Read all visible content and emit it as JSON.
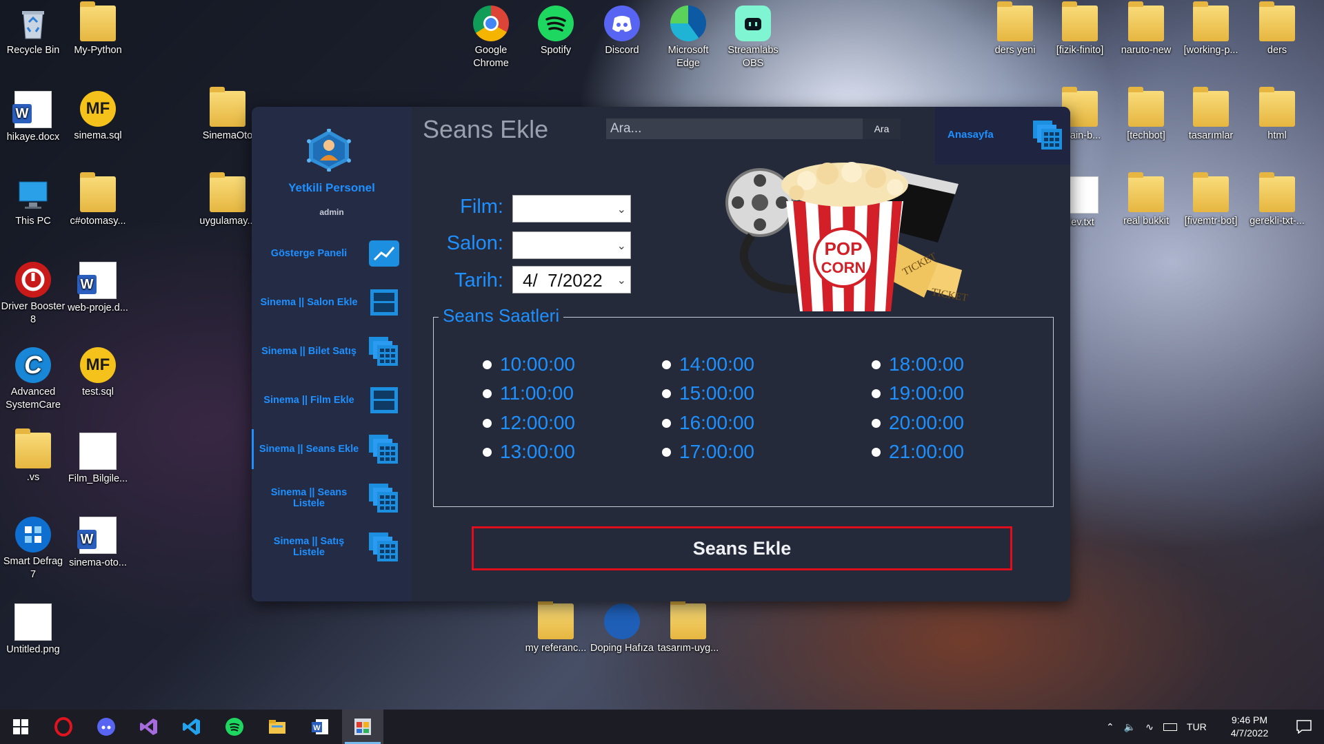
{
  "desktop": {
    "icons": [
      {
        "label": "Recycle Bin"
      },
      {
        "label": "My-Python"
      },
      {
        "label": "hikaye.docx"
      },
      {
        "label": "sinema.sql"
      },
      {
        "label": "SinemaOto"
      },
      {
        "label": "This PC"
      },
      {
        "label": "c#otomasy..."
      },
      {
        "label": "uygulamay..."
      },
      {
        "label": "Driver Booster 8"
      },
      {
        "label": "web-proje.d..."
      },
      {
        "label": "Advanced SystemCare"
      },
      {
        "label": "test.sql"
      },
      {
        "label": ".vs"
      },
      {
        "label": "Film_Bilgile..."
      },
      {
        "label": "Smart Defrag 7"
      },
      {
        "label": "sinema-oto..."
      },
      {
        "label": "Untitled.png"
      },
      {
        "label": "Google Chrome"
      },
      {
        "label": "Spotify"
      },
      {
        "label": "Discord"
      },
      {
        "label": "Microsoft Edge"
      },
      {
        "label": "Streamlabs OBS"
      },
      {
        "label": "ders yeni"
      },
      {
        "label": "[fizik-finito]"
      },
      {
        "label": "naruto-new"
      },
      {
        "label": "[working-p..."
      },
      {
        "label": "ders"
      },
      {
        "label": "ytrain-b..."
      },
      {
        "label": "[techbot]"
      },
      {
        "label": "tasarımlar"
      },
      {
        "label": "html"
      },
      {
        "label": "dev.txt"
      },
      {
        "label": "real bukkit"
      },
      {
        "label": "[fivemtr-bot]"
      },
      {
        "label": "gerekli-txt-..."
      },
      {
        "label": "my referanc..."
      },
      {
        "label": "Doping Hafıza"
      },
      {
        "label": "tasarım-uyg..."
      }
    ]
  },
  "app": {
    "sidebar": {
      "user_title": "Yetkili Personel",
      "user_role": "admin",
      "items": [
        {
          "label": "Gösterge Paneli"
        },
        {
          "label": "Sinema || Salon Ekle"
        },
        {
          "label": "Sinema || Bilet Satış"
        },
        {
          "label": "Sinema || Film Ekle"
        },
        {
          "label": "Sinema || Seans Ekle"
        },
        {
          "label": "Sinema || Seans Listele"
        },
        {
          "label": "Sinema || Satış Listele"
        }
      ]
    },
    "header": {
      "title": "Seans Ekle",
      "search_placeholder": "Ara...",
      "search_button": "Ara",
      "home_label": "Anasayfa"
    },
    "form": {
      "film_label": "Film:",
      "film_value": "",
      "salon_label": "Salon:",
      "salon_value": "",
      "tarih_label": "Tarih:",
      "tarih_value": "4/  7/2022"
    },
    "poster": {
      "popcorn_text_1": "POP",
      "popcorn_text_2": "CORN",
      "ticket_text_1": "TICKET",
      "ticket_text_2": "TICKET"
    },
    "sessions": {
      "title": "Seans Saatleri",
      "col1": [
        "10:00:00",
        "11:00:00",
        "12:00:00",
        "13:00:00"
      ],
      "col2": [
        "14:00:00",
        "15:00:00",
        "16:00:00",
        "17:00:00"
      ],
      "col3": [
        "18:00:00",
        "19:00:00",
        "20:00:00",
        "21:00:00"
      ]
    },
    "submit_label": "Seans Ekle",
    "colors": {
      "accent": "#1e90ff",
      "submit_border": "#e00d1c",
      "sidebar": "#242b45",
      "main": "#242a3a"
    }
  },
  "taskbar": {
    "tray": {
      "language": "TUR",
      "time": "9:46 PM",
      "date": "4/7/2022"
    }
  }
}
